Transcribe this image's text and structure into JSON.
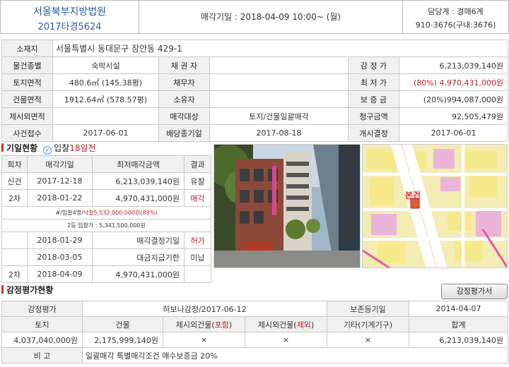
{
  "header": {
    "court": "서울북부지방법원",
    "case_no": "2017타경5624",
    "sale_date": "매각기일 : 2018-04-09  10:00~ (월)",
    "staff": "담당계 : 경매6계",
    "phone": "910-3676(구내:3676)"
  },
  "info": {
    "location_label": "소재지",
    "location_value": "서울특별시 동대문구 장안동 429-1",
    "rows": [
      {
        "l1": "물건종별",
        "v1": "숙박시설",
        "l2": "채 권 자",
        "v2": "",
        "l3": "감 정 가",
        "v3": "6,213,039,140원"
      },
      {
        "l1": "토지면적",
        "v1": "480.6㎡ (145.38평)",
        "l2": "채무자",
        "v2": "",
        "l3": "최 저 가",
        "v3": "(80%) 4,970,431,000원"
      },
      {
        "l1": "건물면적",
        "v1": "1912.64㎡ (578.57평)",
        "l2": "소유자",
        "v2": "",
        "l3": "보 증 금",
        "v3": "(20%)994,087,000원"
      },
      {
        "l1": "제시외면적",
        "v1": "",
        "l2": "매각대상",
        "v2": "토지/건물일괄매각",
        "l3": "청구금액",
        "v3": "92,505,479원"
      },
      {
        "l1": "사건접수",
        "v1": "2017-06-01",
        "l2": "배당종기일",
        "v2": "2017-08-18",
        "l3": "개시결정",
        "v3": "2017-06-01"
      }
    ]
  },
  "history": {
    "title": "기일현황",
    "badge_pre": "입찰",
    "badge_days": "18일전",
    "headers": [
      "회차",
      "매각기일",
      "최저매각금액",
      "결과"
    ],
    "r1": {
      "round": "신건",
      "date": "2017-12-18",
      "amount": "6,213,039,140원",
      "result": "유찰"
    },
    "r2": {
      "round": "2차",
      "date": "2018-01-22",
      "amount": "4,970,431,000원",
      "result": "매각"
    },
    "note1_a": "#/입찰4명/",
    "note1_b": "낙찰5,532,000,000원(89%)",
    "note2": "2등 입찰가 : 5,341,500,000원",
    "r3": {
      "date": "2018-01-29",
      "event": "매각결정기일",
      "result": "허가"
    },
    "r4": {
      "date": "2018-03-05",
      "event": "대금지급기한",
      "result": "미납"
    },
    "r5": {
      "round": "2차",
      "date": "2018-04-09",
      "amount": "4,970,431,000원",
      "result": ""
    }
  },
  "map": {
    "marker_label": "본건"
  },
  "appraisal": {
    "title": "감정평가현황",
    "button": "감정평가서",
    "r1_label": "감정평가",
    "r1_value": "하보나감정/2017-06-12",
    "r1_label2": "보존등기일",
    "r1_value2": "2014-04-07",
    "headers": [
      "토지",
      "건물",
      "제시외건물(",
      "포함",
      ")",
      "제시외건물(",
      "제외",
      ")",
      "기타(기계기구)",
      "합계"
    ],
    "values": [
      "4,037,040,000원",
      "2,175,999,140원",
      "×",
      "×",
      "×",
      "6,213,039,140원"
    ],
    "note_label": "비 고",
    "note_value": "일괄매각 특별매각조건 매수보증금 20%"
  },
  "colors": {
    "accent_red": "#b4232a",
    "court_blue": "#2c5aa0",
    "label_bg": "#f0f0f0"
  }
}
